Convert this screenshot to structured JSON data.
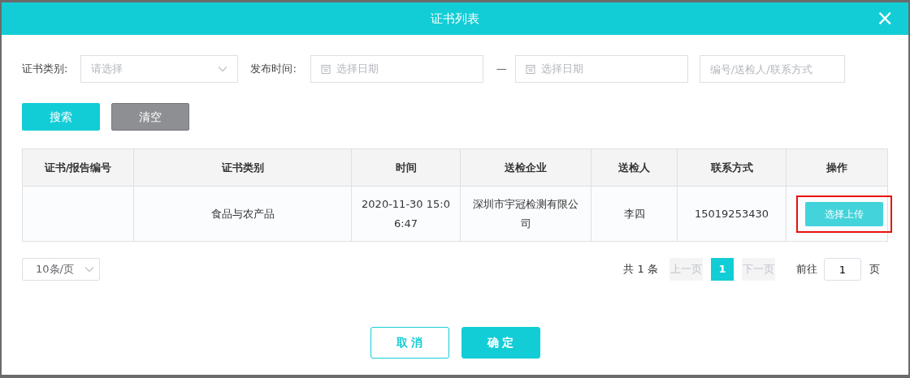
{
  "dialog": {
    "title": "证书列表",
    "close": "×"
  },
  "filters": [
    {
      "kind": "select",
      "label": "证书类别:",
      "placeholder": "请选择"
    },
    {
      "kind": "daterange",
      "label": "发布时间:",
      "start_placeholder": "选择日期",
      "separator": "—",
      "end_placeholder": "选择日期"
    },
    {
      "kind": "text",
      "placeholder": "编号/送检人/联系方式"
    }
  ],
  "actions": [
    {
      "kind": "primary",
      "label": "搜索"
    },
    {
      "kind": "secondary",
      "label": "清空"
    }
  ],
  "table": {
    "columns": [
      "证书/报告编号",
      "证书类别",
      "时间",
      "送检企业",
      "送检人",
      "联系方式",
      "操作"
    ],
    "rows": [
      {
        "cells": [
          "",
          "食品与农产品",
          "2020-11-30 15:06:47",
          "深圳市宇冠检测有限公司",
          "李四",
          "15019253430"
        ],
        "action": "选择上传",
        "highlighted": true
      }
    ]
  },
  "pagination": {
    "page_size": "10条/页",
    "total": "共 1 条",
    "prev": {
      "label": "上一页",
      "disabled": true
    },
    "pages": [
      {
        "label": "1",
        "selected": true
      }
    ],
    "next": {
      "label": "下一页",
      "disabled": true
    },
    "goto_label": "前往",
    "goto_value": "1",
    "goto_suffix": "页"
  },
  "footer": [
    {
      "kind": "outline",
      "label": "取 消"
    },
    {
      "kind": "primary",
      "label": "确 定"
    }
  ]
}
